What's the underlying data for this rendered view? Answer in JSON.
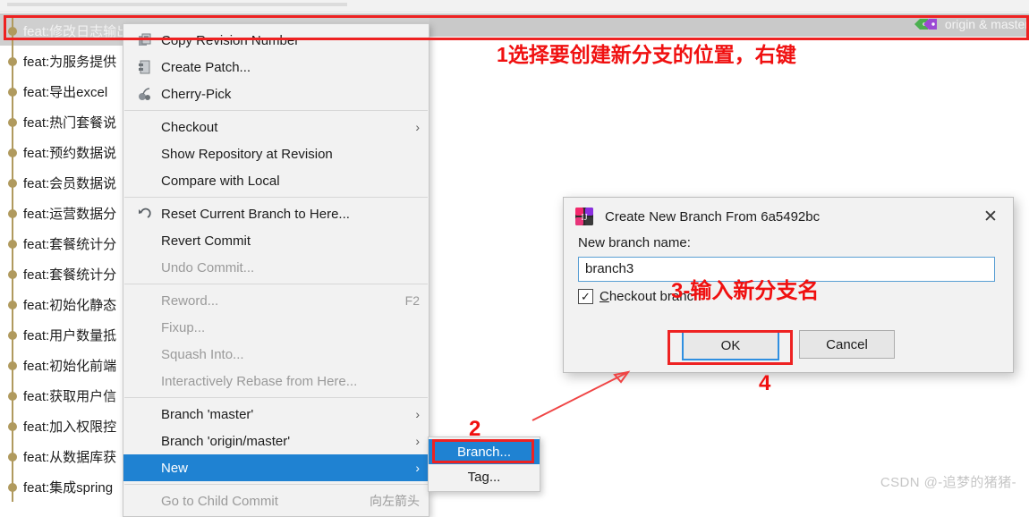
{
  "ide": {
    "header": {
      "branch_label": "origin & master",
      "tag_icon": "tag-icon"
    }
  },
  "commit_list": [
    {
      "message": "feat:修改日志输出位置",
      "selected": true
    },
    {
      "message": "feat:为服务提供",
      "selected": false
    },
    {
      "message": "feat:导出excel",
      "selected": false
    },
    {
      "message": "feat:热门套餐说",
      "selected": false
    },
    {
      "message": "feat:预约数据说",
      "selected": false
    },
    {
      "message": "feat:会员数据说",
      "selected": false
    },
    {
      "message": "feat:运营数据分",
      "selected": false
    },
    {
      "message": "feat:套餐统计分",
      "selected": false
    },
    {
      "message": "feat:套餐统计分",
      "selected": false
    },
    {
      "message": "feat:初始化静态",
      "selected": false
    },
    {
      "message": "feat:用户数量抵",
      "selected": false
    },
    {
      "message": "feat:初始化前端",
      "selected": false
    },
    {
      "message": "feat:获取用户信",
      "selected": false
    },
    {
      "message": "feat:加入权限控",
      "selected": false
    },
    {
      "message": "feat:从数据库获",
      "selected": false
    },
    {
      "message": "feat:集成spring",
      "selected": false
    }
  ],
  "context_menu": {
    "groups": [
      {
        "items": [
          {
            "label": "Copy Revision Number",
            "icon": "copy-icon",
            "state": "enabled",
            "accel": "",
            "submenu": false
          },
          {
            "label": "Create Patch...",
            "icon": "patch-icon",
            "state": "enabled",
            "accel": "",
            "submenu": false
          },
          {
            "label": "Cherry-Pick",
            "icon": "cherry-pick-icon",
            "state": "enabled",
            "accel": "",
            "submenu": false
          }
        ]
      },
      {
        "items": [
          {
            "label": "Checkout",
            "icon": "",
            "state": "enabled",
            "accel": "",
            "submenu": true
          },
          {
            "label": "Show Repository at Revision",
            "icon": "",
            "state": "enabled",
            "accel": "",
            "submenu": false
          },
          {
            "label": "Compare with Local",
            "icon": "",
            "state": "enabled",
            "accel": "",
            "submenu": false
          }
        ]
      },
      {
        "items": [
          {
            "label": "Reset Current Branch to Here...",
            "icon": "reset-icon",
            "state": "enabled",
            "accel": "",
            "submenu": false
          },
          {
            "label": "Revert Commit",
            "icon": "",
            "state": "enabled",
            "accel": "",
            "submenu": false
          },
          {
            "label": "Undo Commit...",
            "icon": "",
            "state": "disabled",
            "accel": "",
            "submenu": false
          }
        ]
      },
      {
        "items": [
          {
            "label": "Reword...",
            "icon": "",
            "state": "disabled",
            "accel": "F2",
            "submenu": false
          },
          {
            "label": "Fixup...",
            "icon": "",
            "state": "disabled",
            "accel": "",
            "submenu": false
          },
          {
            "label": "Squash Into...",
            "icon": "",
            "state": "disabled",
            "accel": "",
            "submenu": false
          },
          {
            "label": "Interactively Rebase from Here...",
            "icon": "",
            "state": "disabled",
            "accel": "",
            "submenu": false
          }
        ]
      },
      {
        "items": [
          {
            "label": "Branch 'master'",
            "icon": "",
            "state": "enabled",
            "accel": "",
            "submenu": true
          },
          {
            "label": "Branch 'origin/master'",
            "icon": "",
            "state": "enabled",
            "accel": "",
            "submenu": true
          },
          {
            "label": "New",
            "icon": "",
            "state": "highlight",
            "accel": "",
            "submenu": true
          }
        ]
      },
      {
        "items": [
          {
            "label": "Go to Child Commit",
            "icon": "",
            "state": "disabled",
            "accel": "向左箭头",
            "submenu": false
          }
        ]
      }
    ]
  },
  "submenu": {
    "items": [
      {
        "label": "Branch...",
        "state": "highlight"
      },
      {
        "label": "Tag...",
        "state": "enabled"
      }
    ]
  },
  "dialog": {
    "title": "Create New Branch From 6a5492bc",
    "icon": "intellij-idea-icon",
    "close_glyph": "✕",
    "branch_name_label": "New branch name:",
    "branch_name_value": "branch3",
    "branch_name_placeholder": "",
    "checkout_checked": true,
    "checkout_check_glyph": "✓",
    "checkout_mnemonic": "C",
    "checkout_label_rest": "heckout branch",
    "ok_label": "OK",
    "cancel_label": "Cancel"
  },
  "annotations": {
    "step1": "1选择要创建新分支的位置，右键",
    "step2": "2",
    "step3": "3-输入新分支名",
    "step4": "4",
    "accent_color": "#ee2222"
  },
  "watermark": "CSDN @-追梦的猪猪-"
}
